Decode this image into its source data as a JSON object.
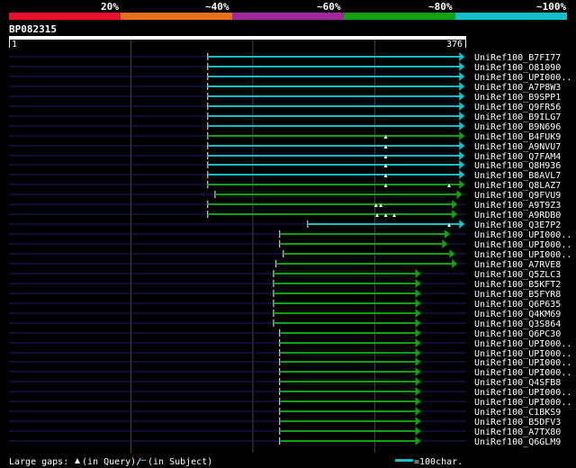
{
  "legend": {
    "labels": [
      "20%",
      "~40%",
      "~60%",
      "~80%",
      "~100%"
    ],
    "colors": [
      "#e8102a",
      "#e8701a",
      "#a0289a",
      "#10a010",
      "#10c0c8"
    ]
  },
  "query": {
    "name": "BP082315",
    "start_label": "1",
    "end_label": "376",
    "length": 376
  },
  "colors": {
    "background": "#000000",
    "ruler": "#ffffff",
    "dark_line": "#1a1a6e",
    "guide": "#444444",
    "cyan": "#10c0c8",
    "green": "#10a010",
    "gap_marker": "#ffffff",
    "text": "#ffffff"
  },
  "hits": [
    {
      "name": "UniRef100_B7FI77",
      "start": 164,
      "end": 374,
      "color": "cyan",
      "qgaps": [],
      "sgaps": []
    },
    {
      "name": "UniRef100_O81090",
      "start": 164,
      "end": 374,
      "color": "cyan",
      "qgaps": [],
      "sgaps": []
    },
    {
      "name": "UniRef100_UPI000..",
      "start": 164,
      "end": 374,
      "color": "cyan",
      "qgaps": [],
      "sgaps": []
    },
    {
      "name": "UniRef100_A7P8W3",
      "start": 164,
      "end": 374,
      "color": "cyan",
      "qgaps": [],
      "sgaps": []
    },
    {
      "name": "UniRef100_B9SPP1",
      "start": 164,
      "end": 374,
      "color": "cyan",
      "qgaps": [],
      "sgaps": []
    },
    {
      "name": "UniRef100_Q9FR56",
      "start": 164,
      "end": 374,
      "color": "cyan",
      "qgaps": [],
      "sgaps": []
    },
    {
      "name": "UniRef100_B9ILG7",
      "start": 164,
      "end": 374,
      "color": "cyan",
      "qgaps": [],
      "sgaps": []
    },
    {
      "name": "UniRef100_B9N696",
      "start": 164,
      "end": 374,
      "color": "cyan",
      "qgaps": [],
      "sgaps": []
    },
    {
      "name": "UniRef100_B4FUK9",
      "start": 164,
      "end": 374,
      "color": "green",
      "qgaps": [
        310
      ],
      "sgaps": []
    },
    {
      "name": "UniRef100_A9NVU7",
      "start": 164,
      "end": 374,
      "color": "cyan",
      "qgaps": [
        310
      ],
      "sgaps": []
    },
    {
      "name": "UniRef100_Q7FAM4",
      "start": 164,
      "end": 374,
      "color": "cyan",
      "qgaps": [
        310
      ],
      "sgaps": []
    },
    {
      "name": "UniRef100_Q8H936",
      "start": 164,
      "end": 374,
      "color": "cyan",
      "qgaps": [
        310
      ],
      "sgaps": []
    },
    {
      "name": "UniRef100_B8AVL7",
      "start": 164,
      "end": 374,
      "color": "cyan",
      "qgaps": [
        310
      ],
      "sgaps": []
    },
    {
      "name": "UniRef100_Q8LAZ7",
      "start": 164,
      "end": 374,
      "color": "green",
      "qgaps": [
        310,
        362
      ],
      "sgaps": []
    },
    {
      "name": "UniRef100_Q9FVU9",
      "start": 170,
      "end": 372,
      "color": "green",
      "qgaps": [],
      "sgaps": []
    },
    {
      "name": "UniRef100_A9T9Z3",
      "start": 164,
      "end": 368,
      "color": "green",
      "qgaps": [
        302,
        306
      ],
      "sgaps": []
    },
    {
      "name": "UniRef100_A9RDB0",
      "start": 164,
      "end": 368,
      "color": "green",
      "qgaps": [
        303,
        310,
        317
      ],
      "sgaps": []
    },
    {
      "name": "UniRef100_Q3E7P2",
      "start": 246,
      "end": 374,
      "color": "cyan",
      "qgaps": [
        362
      ],
      "sgaps": []
    },
    {
      "name": "UniRef100_UPI000..",
      "start": 223,
      "end": 362,
      "color": "green",
      "qgaps": [],
      "sgaps": []
    },
    {
      "name": "UniRef100_UPI000..",
      "start": 223,
      "end": 360,
      "color": "green",
      "qgaps": [],
      "sgaps": []
    },
    {
      "name": "UniRef100_UPI000..",
      "start": 226,
      "end": 366,
      "color": "green",
      "qgaps": [],
      "sgaps": []
    },
    {
      "name": "UniRef100_A7RVE8",
      "start": 220,
      "end": 368,
      "color": "green",
      "qgaps": [],
      "sgaps": []
    },
    {
      "name": "UniRef100_Q5ZLC3",
      "start": 218,
      "end": 338,
      "color": "green",
      "qgaps": [],
      "sgaps": []
    },
    {
      "name": "UniRef100_B5KFT2",
      "start": 218,
      "end": 338,
      "color": "green",
      "qgaps": [],
      "sgaps": []
    },
    {
      "name": "UniRef100_B5FYR8",
      "start": 218,
      "end": 338,
      "color": "green",
      "qgaps": [],
      "sgaps": []
    },
    {
      "name": "UniRef100_Q6P635",
      "start": 218,
      "end": 338,
      "color": "green",
      "qgaps": [],
      "sgaps": []
    },
    {
      "name": "UniRef100_Q4KM69",
      "start": 218,
      "end": 338,
      "color": "green",
      "qgaps": [],
      "sgaps": []
    },
    {
      "name": "UniRef100_Q3S864",
      "start": 218,
      "end": 338,
      "color": "green",
      "qgaps": [],
      "sgaps": []
    },
    {
      "name": "UniRef100_Q6PC30",
      "start": 223,
      "end": 338,
      "color": "green",
      "qgaps": [],
      "sgaps": []
    },
    {
      "name": "UniRef100_UPI000..",
      "start": 223,
      "end": 338,
      "color": "green",
      "qgaps": [],
      "sgaps": []
    },
    {
      "name": "UniRef100_UPI000..",
      "start": 223,
      "end": 338,
      "color": "green",
      "qgaps": [],
      "sgaps": []
    },
    {
      "name": "UniRef100_UPI000..",
      "start": 223,
      "end": 338,
      "color": "green",
      "qgaps": [],
      "sgaps": []
    },
    {
      "name": "UniRef100_UPI000..",
      "start": 223,
      "end": 338,
      "color": "green",
      "qgaps": [],
      "sgaps": []
    },
    {
      "name": "UniRef100_Q4SFB8",
      "start": 223,
      "end": 338,
      "color": "green",
      "qgaps": [],
      "sgaps": []
    },
    {
      "name": "UniRef100_UPI000..",
      "start": 223,
      "end": 338,
      "color": "green",
      "qgaps": [],
      "sgaps": []
    },
    {
      "name": "UniRef100_UPI000..",
      "start": 223,
      "end": 338,
      "color": "green",
      "qgaps": [],
      "sgaps": []
    },
    {
      "name": "UniRef100_C1BKS9",
      "start": 223,
      "end": 338,
      "color": "green",
      "qgaps": [],
      "sgaps": []
    },
    {
      "name": "UniRef100_B5DFV3",
      "start": 223,
      "end": 338,
      "color": "green",
      "qgaps": [],
      "sgaps": []
    },
    {
      "name": "UniRef100_A7TX80",
      "start": 223,
      "end": 338,
      "color": "green",
      "qgaps": [],
      "sgaps": []
    },
    {
      "name": "UniRef100_Q6GLM9",
      "start": 223,
      "end": 338,
      "color": "green",
      "qgaps": [],
      "sgaps": []
    }
  ],
  "footer": {
    "gaps_label": "Large gaps:",
    "query_gap_text": "(in Query)/",
    "subject_gap_text": "(in Subject)",
    "scale_label": "=100char."
  }
}
